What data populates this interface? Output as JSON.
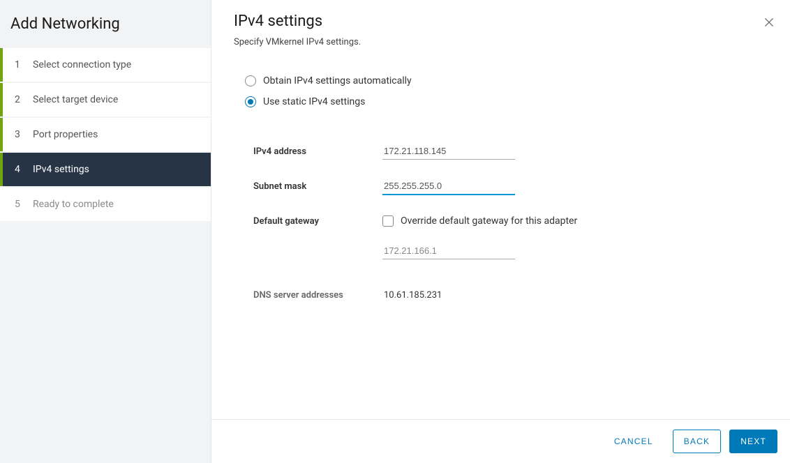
{
  "sidebar": {
    "title": "Add Networking",
    "steps": [
      {
        "num": "1",
        "label": "Select connection type",
        "state": "completed"
      },
      {
        "num": "2",
        "label": "Select target device",
        "state": "completed"
      },
      {
        "num": "3",
        "label": "Port properties",
        "state": "completed"
      },
      {
        "num": "4",
        "label": "IPv4 settings",
        "state": "active"
      },
      {
        "num": "5",
        "label": "Ready to complete",
        "state": "upcoming"
      }
    ]
  },
  "main": {
    "title": "IPv4 settings",
    "subtitle": "Specify VMkernel IPv4 settings.",
    "radios": {
      "auto": "Obtain IPv4 settings automatically",
      "static": "Use static IPv4 settings",
      "selected": "static"
    },
    "fields": {
      "ipv4_label": "IPv4 address",
      "ipv4_value": "172.21.118.145",
      "subnet_label": "Subnet mask",
      "subnet_value": "255.255.255.0",
      "gateway_label": "Default gateway",
      "gateway_checkbox": "Override default gateway for this adapter",
      "gateway_value": "172.21.166.1",
      "dns_label": "DNS server addresses",
      "dns_value": "10.61.185.231"
    }
  },
  "footer": {
    "cancel": "CANCEL",
    "back": "BACK",
    "next": "NEXT"
  }
}
